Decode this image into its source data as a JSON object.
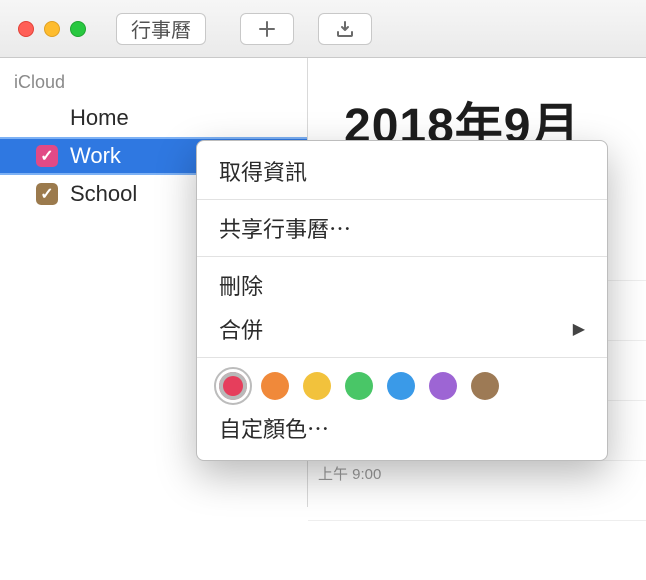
{
  "toolbar": {
    "title": "行事曆"
  },
  "sidebar": {
    "section": "iCloud",
    "items": [
      {
        "label": "Home",
        "color": "#35c65f",
        "selected": false
      },
      {
        "label": "Work",
        "color": "#e14a86",
        "selected": true
      },
      {
        "label": "School",
        "color": "#9b7a4d",
        "selected": false
      }
    ]
  },
  "main": {
    "big_date": "2018年9月",
    "time_label": "上午 9:00"
  },
  "context_menu": {
    "get_info": "取得資訊",
    "share": "共享行事曆⋯",
    "delete": "刪除",
    "merge": "合併",
    "custom_color": "自定顏色⋯",
    "swatches": [
      {
        "color": "#e63e5c",
        "selected": true
      },
      {
        "color": "#f0893a",
        "selected": false
      },
      {
        "color": "#f2c23c",
        "selected": false
      },
      {
        "color": "#49c667",
        "selected": false
      },
      {
        "color": "#3a9ae8",
        "selected": false
      },
      {
        "color": "#9d65d4",
        "selected": false
      },
      {
        "color": "#9d7a55",
        "selected": false
      }
    ]
  }
}
